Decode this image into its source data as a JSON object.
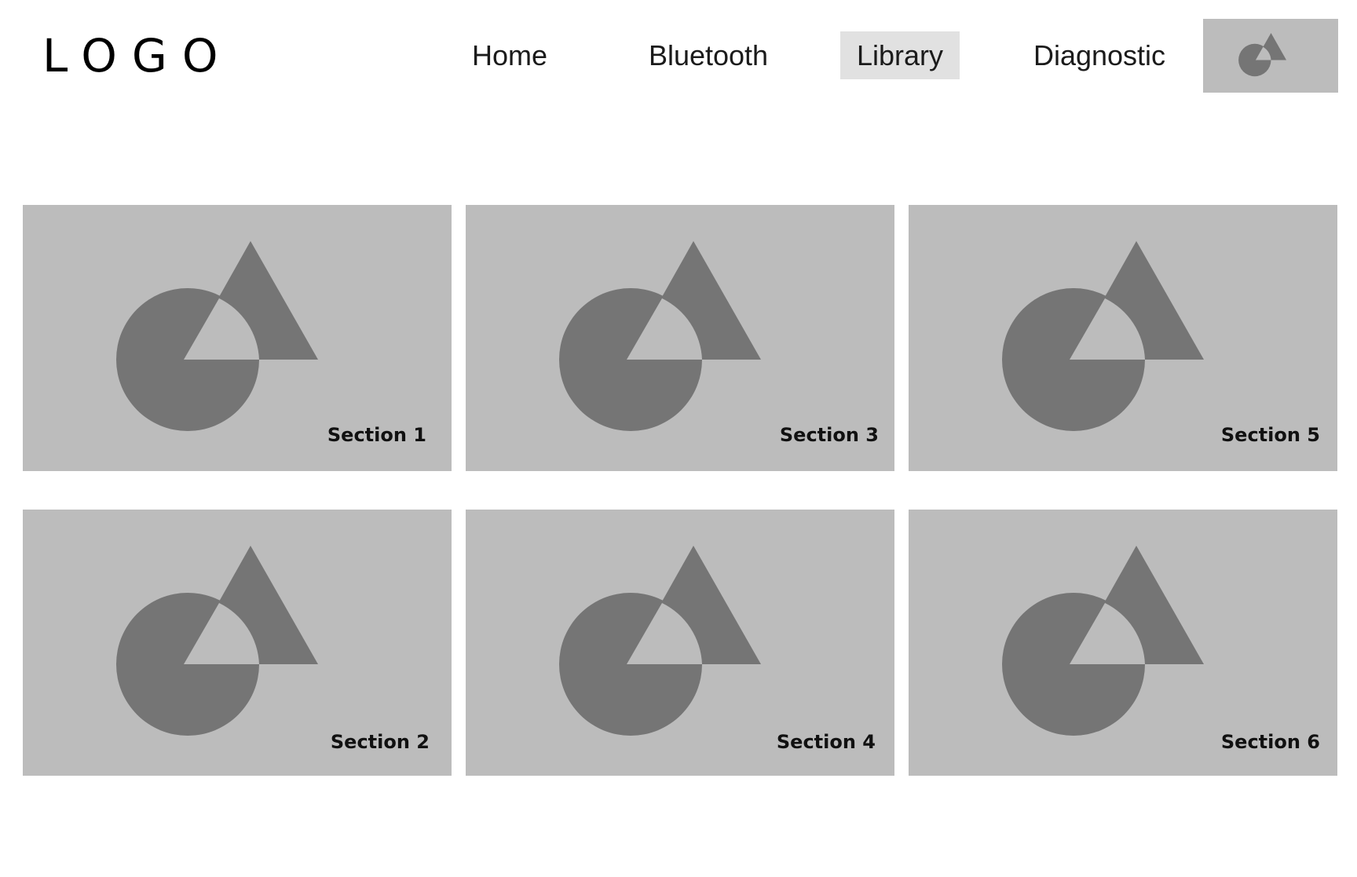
{
  "header": {
    "logo_text": "LOGO",
    "nav": [
      {
        "label": "Home",
        "active": false
      },
      {
        "label": "Bluetooth",
        "active": false
      },
      {
        "label": "Library",
        "active": true
      },
      {
        "label": "Diagnostic",
        "active": false
      }
    ],
    "profile_icon": "image-placeholder-icon"
  },
  "sections": [
    {
      "label": "Section 1",
      "icon": "image-placeholder-icon"
    },
    {
      "label": "Section 3",
      "icon": "image-placeholder-icon"
    },
    {
      "label": "Section 5",
      "icon": "image-placeholder-icon"
    },
    {
      "label": "Section 2",
      "icon": "image-placeholder-icon"
    },
    {
      "label": "Section 4",
      "icon": "image-placeholder-icon"
    },
    {
      "label": "Section 6",
      "icon": "image-placeholder-icon"
    }
  ],
  "colors": {
    "placeholder_bg": "#bcbcbc",
    "placeholder_shape": "#757575",
    "active_nav_bg": "#e1e1e1"
  }
}
